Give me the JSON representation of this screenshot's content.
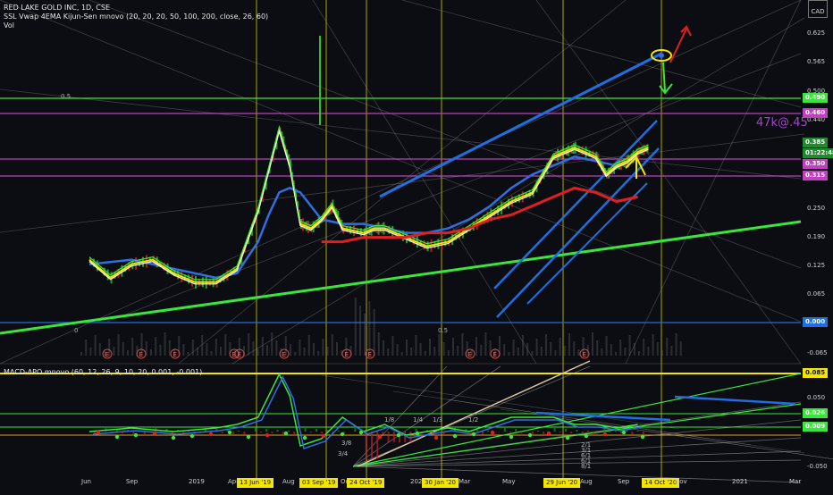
{
  "header": {
    "title": "RED LAKE GOLD INC, 1D, CSE",
    "indicators": "SSL Vwap 4EMA Kijun-Sen mnovo (20, 20, 20, 50, 100, 200, close, 26, 60)",
    "vol": "Vol",
    "currency_top": "",
    "currency": "CAD"
  },
  "macd_label": "MACD-APO mnovo (60, 12, 26, 9, 10, 20, 0.001, -0.001)",
  "annotation": "47k@.45",
  "colors": {
    "bg": "#0b0d12",
    "green": "#39e639",
    "magenta": "#c040c0",
    "blue": "#1f6fe0",
    "yellow": "#f2e600",
    "red": "#e02020"
  },
  "chart_data": [
    {
      "type": "line",
      "title": "RED LAKE GOLD INC, 1D, CSE",
      "xlabel": "",
      "ylabel": "",
      "x_ticks": [
        "Jun",
        "Sep",
        "2019",
        "Apr",
        "13 Jun '19",
        "Aug",
        "03 Sep '19",
        "Oct",
        "24 Oct '19",
        "2020",
        "30 Jan '20",
        "Mar",
        "May",
        "29 Jun '20",
        "Aug",
        "Sep",
        "14 Oct '20",
        "Nov",
        "2021",
        "Mar"
      ],
      "highlighted_dates": [
        "13 Jun '19",
        "03 Sep '19",
        "24 Oct '19",
        "30 Jan '20",
        "29 Jun '20",
        "14 Oct '20"
      ],
      "y_ticks": [
        "0.625",
        "0.565",
        "0.500",
        "0.440",
        "0.385",
        "0.250",
        "0.190",
        "0.125",
        "0.065",
        "0.000",
        "-0.065"
      ],
      "price_tags": [
        {
          "label": "0.490",
          "color": "#39e639"
        },
        {
          "label": "0.460",
          "color": "#c040c0"
        },
        {
          "label": "0.385",
          "color": "#1e8c2c"
        },
        {
          "label": "01:22:48",
          "color": "#1e8c2c"
        },
        {
          "label": "0.350",
          "color": "#c040c0"
        },
        {
          "label": "0.315",
          "color": "#c040c0"
        },
        {
          "label": "0.000",
          "color": "#1f6fe0"
        }
      ],
      "horizontal_levels": [
        0.49,
        0.46,
        0.35,
        0.315,
        0.0
      ],
      "fib_labels": [
        "0.5",
        "0",
        "0.5"
      ],
      "earnings_markers": [
        "E",
        "E",
        "E",
        "E",
        "E",
        "E",
        "E",
        "E",
        "E",
        "E",
        "E"
      ],
      "series": [
        {
          "name": "",
          "color": "#ffffff",
          "x": [
            0,
            2,
            4,
            6,
            8,
            10,
            12,
            14,
            16,
            18,
            19,
            20,
            21,
            22,
            23,
            24,
            26,
            27,
            28,
            30,
            32,
            34,
            36,
            38,
            40,
            42,
            44,
            45,
            46,
            48,
            49,
            50,
            51,
            52,
            53
          ],
          "values": [
            0.14,
            0.1,
            0.13,
            0.14,
            0.11,
            0.09,
            0.09,
            0.12,
            0.25,
            0.43,
            0.35,
            0.22,
            0.21,
            0.23,
            0.26,
            0.21,
            0.2,
            0.21,
            0.21,
            0.19,
            0.17,
            0.18,
            0.21,
            0.24,
            0.27,
            0.29,
            0.37,
            0.38,
            0.39,
            0.37,
            0.33,
            0.35,
            0.36,
            0.38,
            0.39
          ]
        },
        {
          "name": "",
          "color": "#2f6fe0",
          "x": [
            0,
            4,
            8,
            12,
            14,
            16,
            17,
            18,
            19,
            20,
            22,
            24,
            26,
            28,
            30,
            32,
            34,
            36,
            38,
            40,
            42,
            44,
            46,
            48,
            50
          ],
          "values": [
            0.13,
            0.14,
            0.12,
            0.1,
            0.11,
            0.18,
            0.24,
            0.29,
            0.3,
            0.29,
            0.23,
            0.22,
            0.22,
            0.21,
            0.2,
            0.2,
            0.21,
            0.23,
            0.26,
            0.3,
            0.33,
            0.35,
            0.37,
            0.36,
            0.35
          ]
        },
        {
          "name": "",
          "color": "#e02020",
          "x": [
            22,
            24,
            26,
            28,
            30,
            32,
            34,
            36,
            38,
            40,
            42,
            44,
            46,
            48,
            50,
            52
          ],
          "values": [
            0.18,
            0.18,
            0.19,
            0.19,
            0.19,
            0.2,
            0.2,
            0.21,
            0.23,
            0.24,
            0.26,
            0.28,
            0.3,
            0.29,
            0.27,
            0.28
          ]
        }
      ]
    },
    {
      "type": "line",
      "title": "MACD-APO mnovo (60, 12, 26, 9, 10, 20, 0.001, -0.001)",
      "xlabel": "",
      "ylabel": "",
      "y_ticks": [
        "0.085",
        "0.050",
        "0.026",
        "0.009",
        "-0.050"
      ],
      "price_tags": [
        {
          "label": "0.085",
          "color": "#f2e600"
        },
        {
          "label": "0.026",
          "color": "#39e639"
        },
        {
          "label": "0.009",
          "color": "#39e639"
        }
      ],
      "fan_labels": [
        "3/4",
        "1/8",
        "1/4",
        "1/3",
        "1/2",
        "2/1",
        "3/1",
        "3/8",
        "6/1",
        "6/1",
        "8/1"
      ],
      "series": [
        {
          "name": "",
          "color": "#39e639",
          "x": [
            0,
            4,
            8,
            12,
            14,
            16,
            17,
            18,
            19,
            20,
            22,
            24,
            26,
            28,
            30,
            32,
            34,
            36,
            38,
            40,
            42,
            44,
            46,
            48,
            50,
            52
          ],
          "values": [
            0.0,
            0.005,
            0.0,
            0.005,
            0.01,
            0.02,
            0.05,
            0.08,
            0.05,
            -0.02,
            -0.01,
            0.02,
            0.0,
            0.01,
            -0.005,
            0.0,
            0.005,
            0.0,
            0.01,
            0.02,
            0.02,
            0.02,
            0.01,
            0.01,
            0.005,
            0.01
          ]
        }
      ]
    }
  ]
}
